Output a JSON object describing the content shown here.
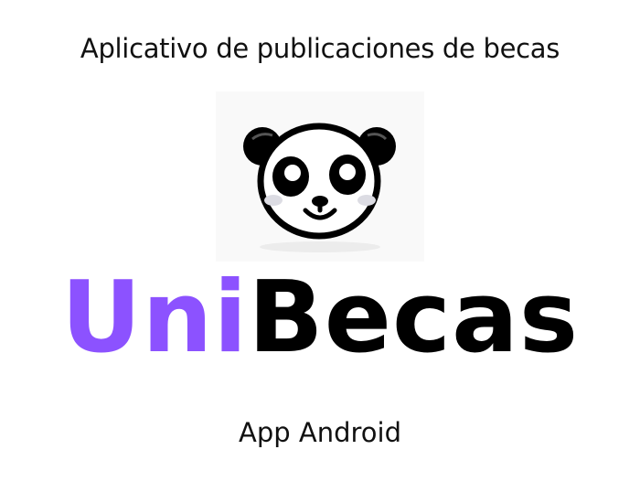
{
  "header": {
    "tagline": "Aplicativo de publicaciones de becas"
  },
  "logo": {
    "icon": "panda-icon",
    "brand_part1": "Uni",
    "brand_part2": "Becas"
  },
  "footer": {
    "platform": "App Android"
  },
  "colors": {
    "accent": "#8c52ff",
    "text": "#000000",
    "background": "#ffffff"
  }
}
